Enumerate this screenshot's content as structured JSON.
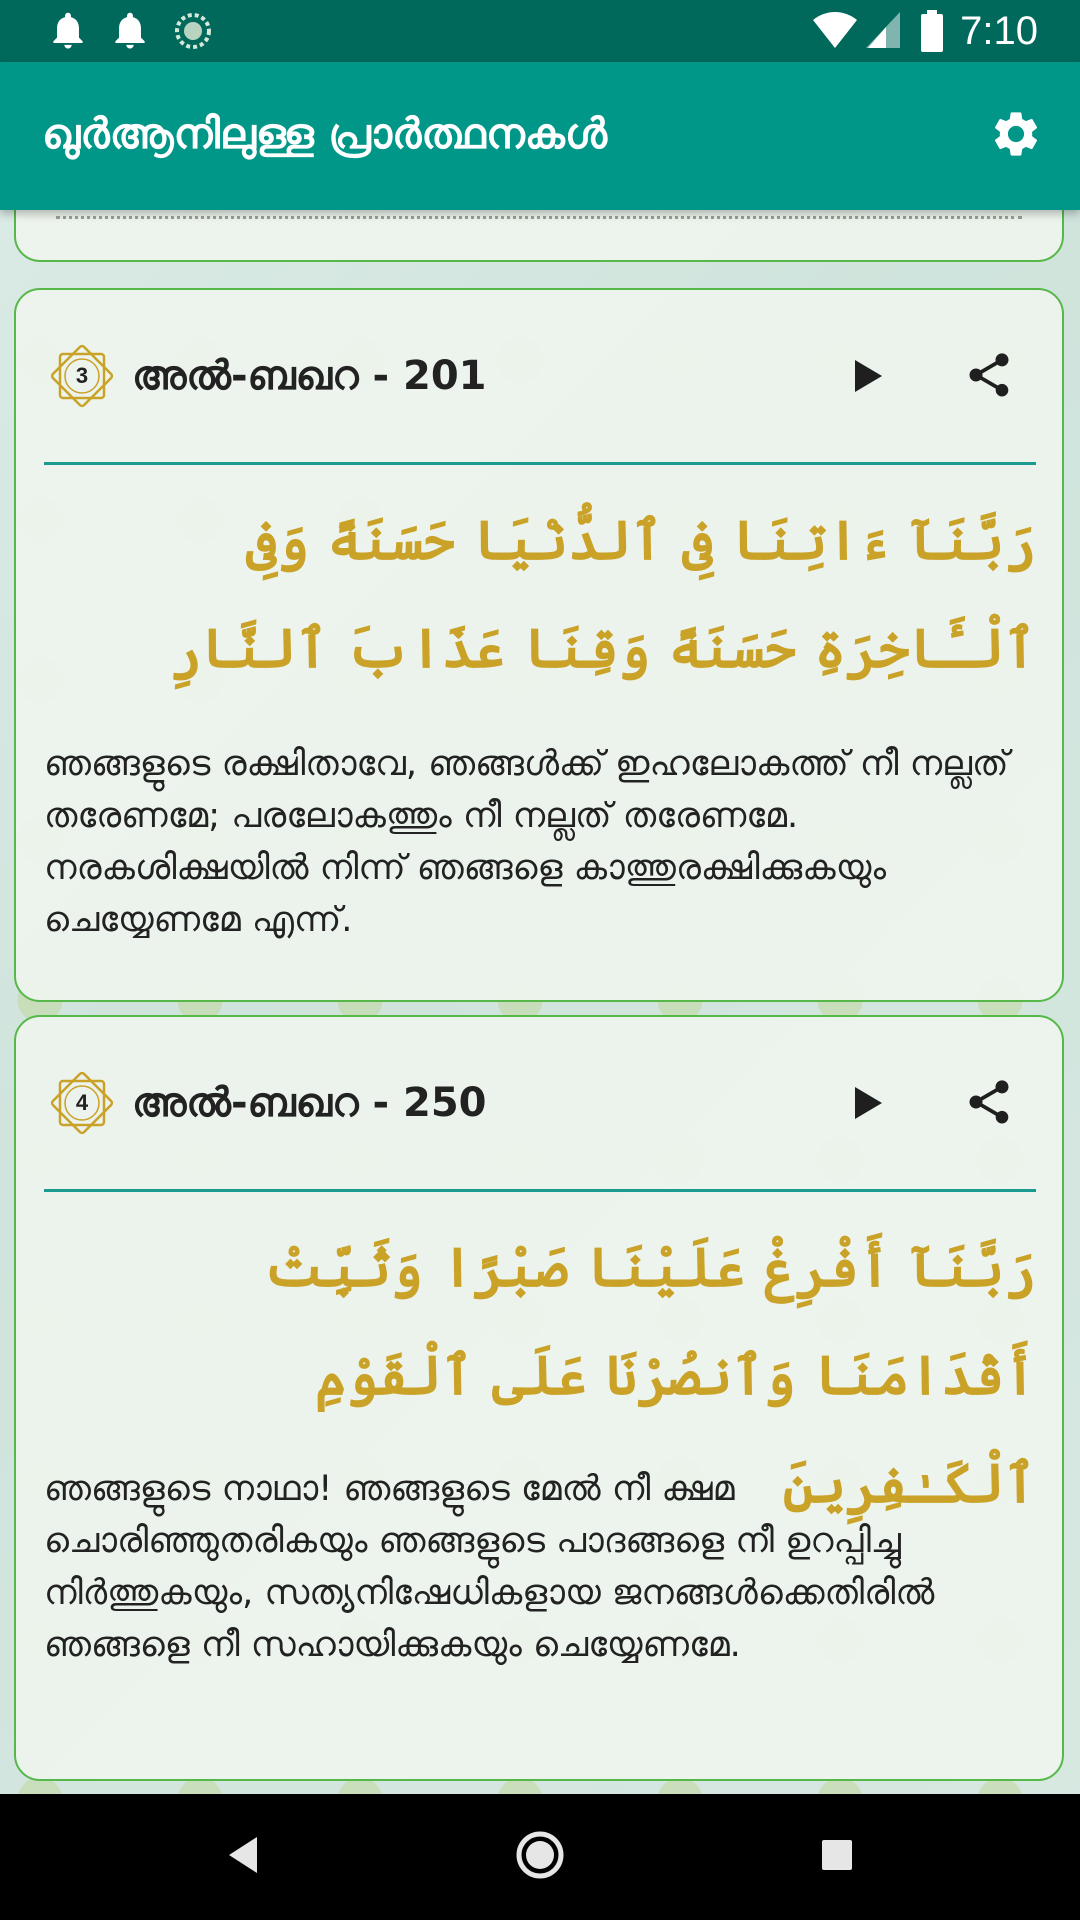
{
  "status_bar": {
    "time": "7:10",
    "icons": [
      "notification-bell-icon",
      "notification-bell-icon",
      "loading-circle-icon",
      "wifi-icon",
      "cell-signal-icon",
      "battery-icon"
    ]
  },
  "app_bar": {
    "title": "ഖുർആനിലുള്ള പ്രാർത്ഥനകൾ",
    "settings_icon": "gear-icon"
  },
  "colors": {
    "status_bar": "#00695c",
    "app_bar": "#009688",
    "arabic_text": "#c9a227",
    "card_border": "#57b84a",
    "divider": "#1b9b8f"
  },
  "cards": [
    {
      "number": "3",
      "reference": "അൽ-ബഖറ - 201",
      "arabic": "رَبَّنَآ ءَاتِنَا فِى ٱلدُّنْيَا حَسَنَةً وَفِى ٱلْـَٔاخِرَةِ حَسَنَةً وَقِنَا عَذَابَ ٱلنَّارِ",
      "translation": "ഞങ്ങളുടെ രക്ഷിതാവേ, ഞങ്ങള്‍ക്ക് ഇഹലോകത്ത് നീ നല്ലത് തരേണമേ; പരലോകത്തും നീ നല്ലത് തരേണമേ. നരകശിക്ഷയില്‍ നിന്ന് ഞങ്ങളെ കാത്തുരക്ഷിക്കുകയും ചെയ്യേണമേ എന്ന്."
    },
    {
      "number": "4",
      "reference": "അൽ-ബഖറ - 250",
      "arabic": "رَبَّنَآ أَفْرِغْ عَلَيْنَا صَبْرًا وَثَبِّتْ أَقْدَامَنَا وَٱنصُرْنَا عَلَى ٱلْقَوْمِ ٱلْكَـٰفِرِينَ",
      "translation": "ഞങ്ങളുടെ നാഥാ! ഞങ്ങളുടെ മേല്‍ നീ ക്ഷമ ചൊരിഞ്ഞുതരികയും ഞങ്ങളുടെ പാദങ്ങളെ നീ ഉറപ്പിച്ചു നിര്‍ത്തുകയും, സത്യനിഷേധികളായ ജനങ്ങള്‍ക്കെതിരില്‍ ഞങ്ങളെ നീ സഹായിക്കുകയും ചെയ്യേണമേ."
    }
  ],
  "nav_bar": {
    "icons": [
      "back-icon",
      "home-icon",
      "recents-icon"
    ]
  }
}
